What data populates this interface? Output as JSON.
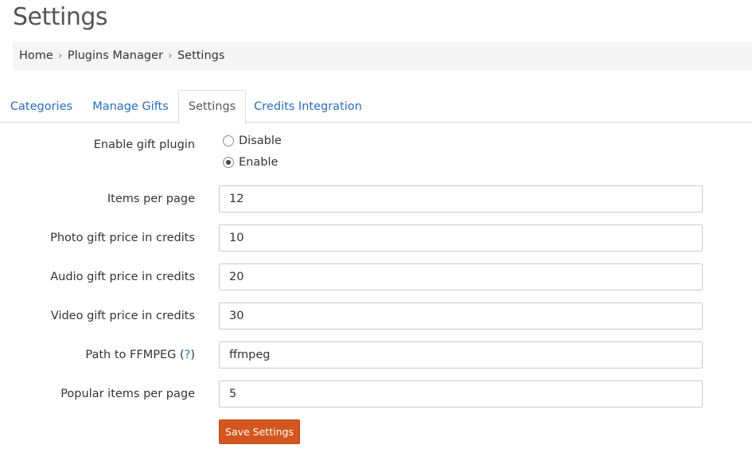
{
  "page": {
    "title": "Settings"
  },
  "breadcrumb": {
    "items": [
      "Home",
      "Plugins Manager",
      "Settings"
    ]
  },
  "tabs": [
    {
      "label": "Categories"
    },
    {
      "label": "Manage Gifts"
    },
    {
      "label": "Settings"
    },
    {
      "label": "Credits Integration"
    }
  ],
  "form": {
    "enable_plugin": {
      "label": "Enable gift plugin",
      "options": [
        "Disable",
        "Enable"
      ],
      "selected": "Enable"
    },
    "items_per_page": {
      "label": "Items per page",
      "value": "12"
    },
    "photo_price": {
      "label": "Photo gift price in credits",
      "value": "10"
    },
    "audio_price": {
      "label": "Audio gift price in credits",
      "value": "20"
    },
    "video_price": {
      "label": "Video gift price in credits",
      "value": "30"
    },
    "ffmpeg_path": {
      "label_prefix": "Path to FFMPEG (",
      "help": "?",
      "label_suffix": ")",
      "value": "ffmpeg"
    },
    "popular_per_page": {
      "label": "Popular items per page",
      "value": "5"
    },
    "save_label": "Save Settings"
  }
}
